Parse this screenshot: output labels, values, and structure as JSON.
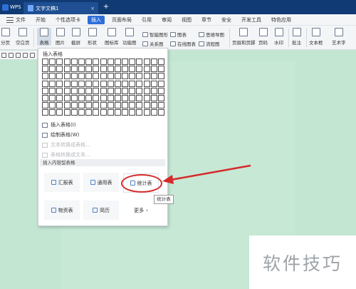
{
  "titlebar": {
    "app_tab": "WPS",
    "doc_tab": "文字文稿1",
    "close_glyph": "×",
    "add_glyph": "+"
  },
  "menubar": {
    "file": "文件",
    "items": [
      "开始",
      "个性选项卡",
      "插入",
      "页面布局",
      "引用",
      "审阅",
      "视图",
      "章节",
      "安全",
      "开发工具",
      "特色应用"
    ]
  },
  "ribbon": {
    "btn_page": "分页",
    "btn_blank_page": "空白页",
    "btn_table": "表格",
    "btn_picture": "图片",
    "btn_screenshot": "截屏",
    "btn_shape": "形状",
    "btn_gallery": "图标库",
    "btn_function": "功能图",
    "btn_smartart": "智能图形",
    "btn_relation": "关系图",
    "btn_chart": "图表",
    "btn_online_chart": "在线图表",
    "btn_mindmap": "思维导图",
    "btn_flowchart": "流程图",
    "btn_header_footer": "页眉和页脚",
    "btn_page_num": "页码",
    "btn_watermark": "水印",
    "btn_comment": "批注",
    "btn_textbox": "文本框",
    "btn_wordart": "艺术字"
  },
  "dropdown": {
    "header": "插入表格",
    "rows": 8,
    "cols": 17,
    "opt_insert": "插入表格(I)",
    "opt_draw": "绘制表格(W)",
    "opt_text_to_table": "文本转换成表格...",
    "opt_table_to_text": "表格转换成文本...",
    "section": "插入内容型表格",
    "card_report": "汇报表",
    "card_general": "通用表",
    "card_stats": "统计表",
    "card_material": "物资表",
    "card_resume": "简历",
    "card_more": "更多",
    "more_glyph": "›"
  },
  "tooltip": "统计表",
  "watermark": "软件技巧",
  "colors": {
    "accent": "#2d6ed9",
    "titlebar": "#0f3a73",
    "annotation_red": "#d52a2a",
    "canvas": "#c3e6d3"
  }
}
